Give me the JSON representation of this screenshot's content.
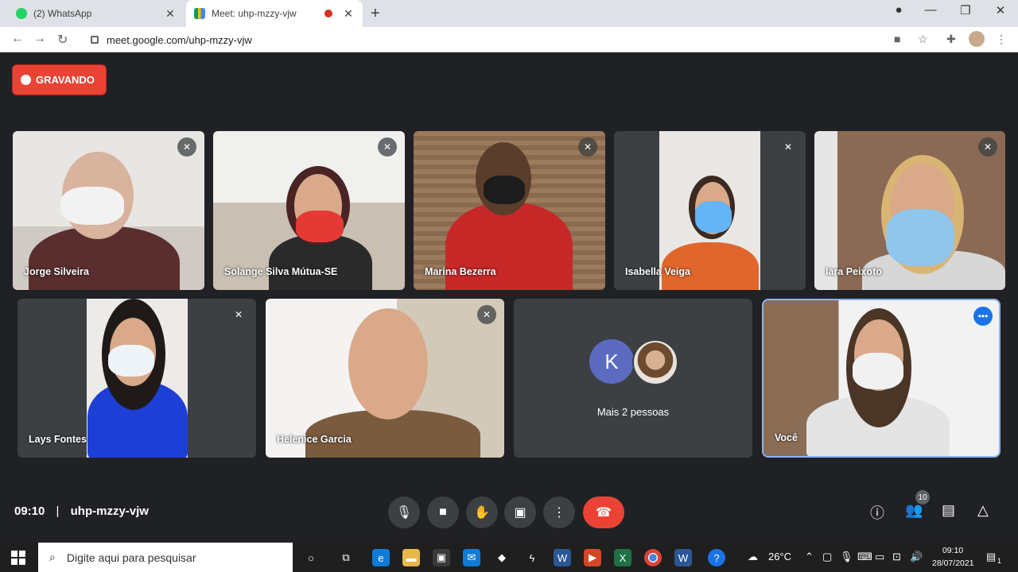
{
  "browser": {
    "tabs": [
      {
        "label": "(2) WhatsApp",
        "icon": "whatsapp-icon"
      },
      {
        "label": "Meet: uhp-mzzy-vjw",
        "icon": "google-meet-icon",
        "recording": true
      }
    ],
    "url": "meet.google.com/uhp-mzzy-vjw"
  },
  "meet": {
    "recording_label": "GRAVANDO",
    "participants": [
      {
        "name": "Jorge Silveira",
        "muted": true
      },
      {
        "name": "Solange Silva Mútua-SE",
        "muted": true
      },
      {
        "name": "Marina Bezerra",
        "muted": true
      },
      {
        "name": "Isabella Veiga",
        "muted": true
      },
      {
        "name": "Iara Peixoto",
        "muted": true
      },
      {
        "name": "Lays Fontes",
        "muted": true
      },
      {
        "name": "Helenice Garcia",
        "muted": true
      },
      {
        "name": "Você",
        "muted": false
      }
    ],
    "more_tile": {
      "avatar_letter": "K",
      "label": "Mais 2 pessoas"
    },
    "time": "09:10",
    "separator": "|",
    "meeting_code": "uhp-mzzy-vjw",
    "participant_count": "10"
  },
  "taskbar": {
    "search_placeholder": "Digite aqui para pesquisar",
    "temperature": "26°C",
    "time": "09:10",
    "date": "28/07/2021",
    "notification_count": "1"
  },
  "colors": {
    "meet_background": "#202124",
    "record_red": "#ea4335",
    "end_call_red": "#ea4335",
    "self_tile_outline": "#8ab4f8"
  }
}
